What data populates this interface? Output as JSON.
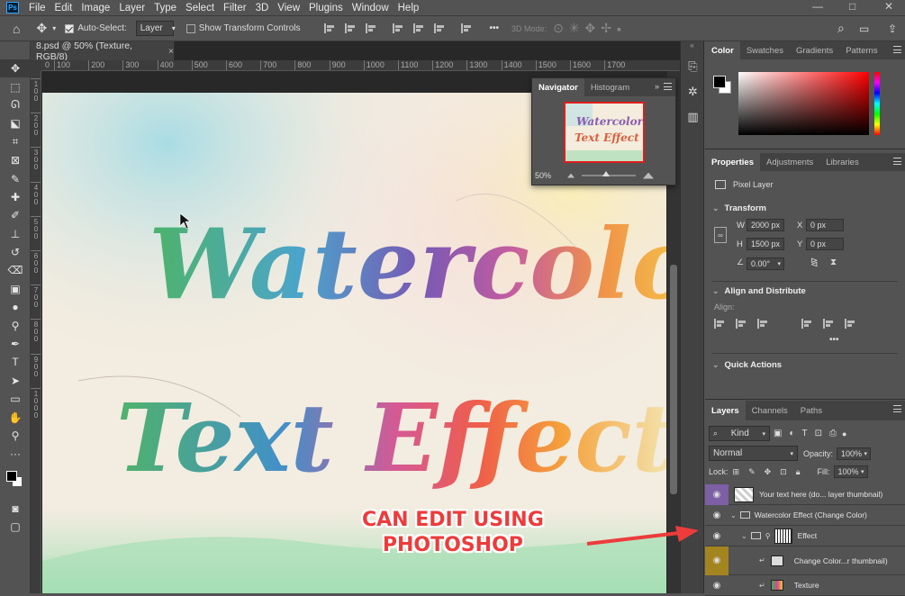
{
  "app": {
    "logo_text": "Ps",
    "menu": [
      "File",
      "Edit",
      "Image",
      "Layer",
      "Type",
      "Select",
      "Filter",
      "3D",
      "View",
      "Plugins",
      "Window",
      "Help"
    ],
    "window_controls": [
      "—",
      "□",
      "✕"
    ]
  },
  "options_bar": {
    "auto_select_label": "Auto-Select:",
    "auto_select_value": "Layer",
    "show_transform_label": "Show Transform Controls",
    "more": "•••",
    "mode_3d_label": "3D Mode:"
  },
  "document": {
    "tab_title": "8.psd @ 50% (Texture, RGB/8)",
    "tab_close": "×",
    "ruler_marks": [
      "100",
      "200",
      "300",
      "400",
      "500",
      "600",
      "700",
      "800",
      "900",
      "1000",
      "1100",
      "1200",
      "1300",
      "1400",
      "1500",
      "1600",
      "1700"
    ],
    "ruler_zero": "0",
    "vruler_marks": [
      "100",
      "200",
      "300",
      "400",
      "500",
      "600",
      "700",
      "800",
      "900",
      "1000"
    ],
    "art_line1": "Watercolor",
    "art_line2": "Text Effect"
  },
  "navigator": {
    "tabs": [
      "Navigator",
      "Histogram"
    ],
    "thumb_line1": "Watercolor",
    "thumb_line2": "Text Effect",
    "zoom": "50%",
    "zoom_fraction": 0.45
  },
  "color_panel": {
    "tabs": [
      "Color",
      "Swatches",
      "Gradients",
      "Patterns"
    ],
    "foreground": "#000000",
    "background": "#ffffff"
  },
  "properties": {
    "tabs": [
      "Properties",
      "Adjustments",
      "Libraries"
    ],
    "layer_type": "Pixel Layer",
    "transform_title": "Transform",
    "w_label": "W",
    "w_value": "2000 px",
    "h_label": "H",
    "h_value": "1500 px",
    "x_label": "X",
    "x_value": "0 px",
    "y_label": "Y",
    "y_value": "0 px",
    "angle_value": "0.00°",
    "align_title": "Align and Distribute",
    "align_label": "Align:",
    "more": "•••",
    "quick_actions_title": "Quick Actions"
  },
  "layers": {
    "tabs": [
      "Layers",
      "Channels",
      "Paths"
    ],
    "filter_kind": "Kind",
    "blend_mode": "Normal",
    "opacity_label": "Opacity:",
    "opacity_value": "100%",
    "lock_label": "Lock:",
    "fill_label": "Fill:",
    "fill_value": "100%",
    "items": [
      {
        "name": "Your text here (do... layer thumbnail)",
        "eye_color": "purple"
      },
      {
        "name": "Watercolor Effect (Change Color)",
        "eye_color": "none"
      },
      {
        "name": "Effect",
        "eye_color": "none"
      },
      {
        "name": "Change Color...r thumbnail)",
        "eye_color": "yellow"
      },
      {
        "name": "Texture",
        "eye_color": "none"
      }
    ]
  },
  "annotation": {
    "line1": "CAN EDIT USING",
    "line2": "PHOTOSHOP",
    "color": "#ee3b3b"
  }
}
